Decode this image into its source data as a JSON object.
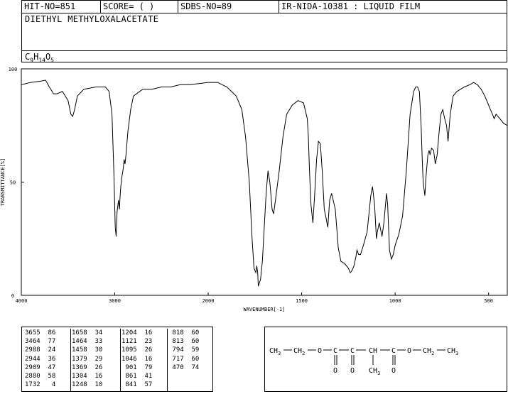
{
  "header": {
    "hit": "HIT-NO=851",
    "score": "SCORE=  (   )",
    "sdbs": "SDBS-NO=89",
    "ir": "IR-NIDA-10381 : LIQUID FILM",
    "compound": "DIETHYL METHYLOXALACETATE",
    "formula_parts": [
      [
        "C",
        ""
      ],
      [
        "9",
        "sub"
      ],
      [
        "H",
        ""
      ],
      [
        "14",
        "sub"
      ],
      [
        "O",
        ""
      ],
      [
        "5",
        "sub"
      ]
    ]
  },
  "chart_data": {
    "type": "line",
    "xlabel": "WAVENUMBER[-1]",
    "ylabel": "TRANSMITTANCE[%]",
    "xlim": [
      4000,
      400
    ],
    "ylim": [
      0,
      100
    ],
    "x_ticks": [
      "4000",
      "3000",
      "2000",
      "1500",
      "1000",
      "500"
    ],
    "x_tick_values": [
      4000,
      3000,
      2000,
      1500,
      1000,
      500
    ],
    "y_ticks": [
      "0",
      "50",
      "100"
    ],
    "y_tick_values": [
      0,
      50,
      100
    ],
    "series": [
      {
        "points": [
          [
            4000,
            93
          ],
          [
            3900,
            94
          ],
          [
            3800,
            94.5
          ],
          [
            3740,
            95
          ],
          [
            3700,
            92
          ],
          [
            3670,
            90
          ],
          [
            3655,
            89
          ],
          [
            3620,
            89
          ],
          [
            3560,
            90
          ],
          [
            3500,
            86
          ],
          [
            3470,
            80
          ],
          [
            3450,
            79
          ],
          [
            3430,
            82
          ],
          [
            3400,
            88
          ],
          [
            3330,
            91
          ],
          [
            3200,
            92
          ],
          [
            3100,
            92
          ],
          [
            3060,
            90
          ],
          [
            3030,
            80
          ],
          [
            3010,
            55
          ],
          [
            2995,
            30
          ],
          [
            2985,
            26
          ],
          [
            2975,
            37
          ],
          [
            2960,
            42
          ],
          [
            2950,
            38
          ],
          [
            2944,
            43
          ],
          [
            2935,
            48
          ],
          [
            2925,
            52
          ],
          [
            2909,
            56
          ],
          [
            2900,
            60
          ],
          [
            2890,
            58
          ],
          [
            2880,
            62
          ],
          [
            2860,
            72
          ],
          [
            2830,
            82
          ],
          [
            2800,
            88
          ],
          [
            2700,
            91
          ],
          [
            2600,
            91
          ],
          [
            2500,
            92
          ],
          [
            2400,
            92
          ],
          [
            2300,
            93
          ],
          [
            2200,
            93
          ],
          [
            2100,
            93.5
          ],
          [
            2000,
            94
          ],
          [
            1950,
            94
          ],
          [
            1900,
            92
          ],
          [
            1850,
            88
          ],
          [
            1820,
            82
          ],
          [
            1800,
            70
          ],
          [
            1780,
            50
          ],
          [
            1765,
            25
          ],
          [
            1755,
            12
          ],
          [
            1745,
            10
          ],
          [
            1740,
            13
          ],
          [
            1735,
            10
          ],
          [
            1732,
            4
          ],
          [
            1720,
            7
          ],
          [
            1710,
            15
          ],
          [
            1700,
            30
          ],
          [
            1690,
            45
          ],
          [
            1680,
            55
          ],
          [
            1670,
            50
          ],
          [
            1658,
            38
          ],
          [
            1650,
            36
          ],
          [
            1640,
            42
          ],
          [
            1620,
            55
          ],
          [
            1600,
            70
          ],
          [
            1580,
            80
          ],
          [
            1550,
            84
          ],
          [
            1520,
            86
          ],
          [
            1490,
            85
          ],
          [
            1470,
            78
          ],
          [
            1464,
            70
          ],
          [
            1458,
            55
          ],
          [
            1450,
            40
          ],
          [
            1440,
            32
          ],
          [
            1430,
            45
          ],
          [
            1420,
            60
          ],
          [
            1410,
            68
          ],
          [
            1400,
            67
          ],
          [
            1390,
            55
          ],
          [
            1379,
            38
          ],
          [
            1369,
            34
          ],
          [
            1360,
            30
          ],
          [
            1350,
            42
          ],
          [
            1340,
            45
          ],
          [
            1320,
            38
          ],
          [
            1304,
            21
          ],
          [
            1290,
            15
          ],
          [
            1270,
            14
          ],
          [
            1260,
            13
          ],
          [
            1250,
            12
          ],
          [
            1240,
            10
          ],
          [
            1230,
            11
          ],
          [
            1220,
            13
          ],
          [
            1210,
            17
          ],
          [
            1204,
            20
          ],
          [
            1195,
            18
          ],
          [
            1185,
            18
          ],
          [
            1170,
            22
          ],
          [
            1150,
            28
          ],
          [
            1140,
            36
          ],
          [
            1130,
            44
          ],
          [
            1121,
            48
          ],
          [
            1110,
            40
          ],
          [
            1100,
            25
          ],
          [
            1095,
            28
          ],
          [
            1085,
            32
          ],
          [
            1070,
            26
          ],
          [
            1060,
            32
          ],
          [
            1046,
            45
          ],
          [
            1040,
            40
          ],
          [
            1030,
            20
          ],
          [
            1020,
            16
          ],
          [
            1010,
            18
          ],
          [
            1000,
            22
          ],
          [
            980,
            27
          ],
          [
            960,
            35
          ],
          [
            940,
            55
          ],
          [
            920,
            80
          ],
          [
            901,
            90
          ],
          [
            890,
            92
          ],
          [
            880,
            92
          ],
          [
            870,
            90
          ],
          [
            861,
            75
          ],
          [
            855,
            60
          ],
          [
            850,
            50
          ],
          [
            841,
            44
          ],
          [
            835,
            52
          ],
          [
            825,
            62
          ],
          [
            818,
            64
          ],
          [
            813,
            62
          ],
          [
            805,
            65
          ],
          [
            794,
            64
          ],
          [
            785,
            58
          ],
          [
            775,
            62
          ],
          [
            765,
            72
          ],
          [
            755,
            80
          ],
          [
            745,
            82
          ],
          [
            735,
            78
          ],
          [
            725,
            75
          ],
          [
            717,
            68
          ],
          [
            705,
            80
          ],
          [
            690,
            88
          ],
          [
            670,
            90
          ],
          [
            650,
            91
          ],
          [
            630,
            92
          ],
          [
            600,
            93
          ],
          [
            580,
            94
          ],
          [
            560,
            93
          ],
          [
            540,
            91
          ],
          [
            520,
            88
          ],
          [
            500,
            84
          ],
          [
            490,
            82
          ],
          [
            480,
            80
          ],
          [
            470,
            78
          ],
          [
            460,
            80
          ],
          [
            440,
            78
          ],
          [
            420,
            76
          ],
          [
            400,
            75
          ]
        ]
      }
    ]
  },
  "peak_table": {
    "columns": [
      [
        [
          "3655",
          "86"
        ],
        [
          "3464",
          "77"
        ],
        [
          "2988",
          "24"
        ],
        [
          "2944",
          "36"
        ],
        [
          "2909",
          "47"
        ],
        [
          "2880",
          "58"
        ],
        [
          "1732",
          "4"
        ]
      ],
      [
        [
          "1658",
          "34"
        ],
        [
          "1464",
          "33"
        ],
        [
          "1458",
          "30"
        ],
        [
          "1379",
          "29"
        ],
        [
          "1369",
          "26"
        ],
        [
          "1304",
          "16"
        ],
        [
          "1248",
          "10"
        ]
      ],
      [
        [
          "1204",
          "16"
        ],
        [
          "1121",
          "23"
        ],
        [
          "1095",
          "26"
        ],
        [
          "1046",
          "16"
        ],
        [
          "901",
          "79"
        ],
        [
          "861",
          "41"
        ],
        [
          "841",
          "57"
        ]
      ],
      [
        [
          "818",
          "60"
        ],
        [
          "813",
          "60"
        ],
        [
          "794",
          "59"
        ],
        [
          "717",
          "60"
        ],
        [
          "470",
          "74"
        ]
      ]
    ]
  },
  "structure": {
    "chain": "CH3-CH2-O-C-C-CH-C-O-CH2-CH3",
    "atoms": {
      "ch3a": "CH",
      "ch3a_sub": "3",
      "ch2a": "CH",
      "ch2a_sub": "2",
      "o1": "O",
      "c1": "C",
      "c2": "C",
      "ch": "CH",
      "c3": "C",
      "o2": "O",
      "ch2b": "CH",
      "ch2b_sub": "2",
      "ch3b": "CH",
      "ch3b_sub": "3",
      "ox1": "O",
      "ox2": "O",
      "me": "CH",
      "me_sub": "3"
    }
  }
}
